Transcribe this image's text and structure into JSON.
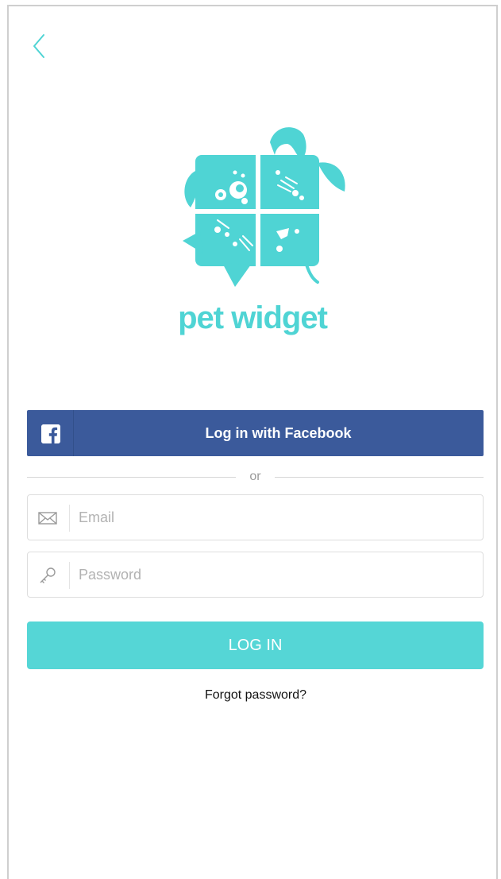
{
  "nav": {
    "back_icon": "chevron-left-icon"
  },
  "brand": {
    "name": "pet widget",
    "accent_color": "#4fd4d4",
    "logo_icon": "pet-widget-logo"
  },
  "facebook": {
    "label": "Log in with Facebook",
    "icon": "facebook-icon",
    "color": "#3b5a9b"
  },
  "divider": {
    "text": "or"
  },
  "form": {
    "email": {
      "placeholder": "Email",
      "value": "",
      "icon": "envelope-icon"
    },
    "password": {
      "placeholder": "Password",
      "value": "",
      "icon": "key-icon"
    },
    "submit_label": "LOG IN",
    "submit_color": "#55d6d6"
  },
  "forgot_password": "Forgot password?"
}
